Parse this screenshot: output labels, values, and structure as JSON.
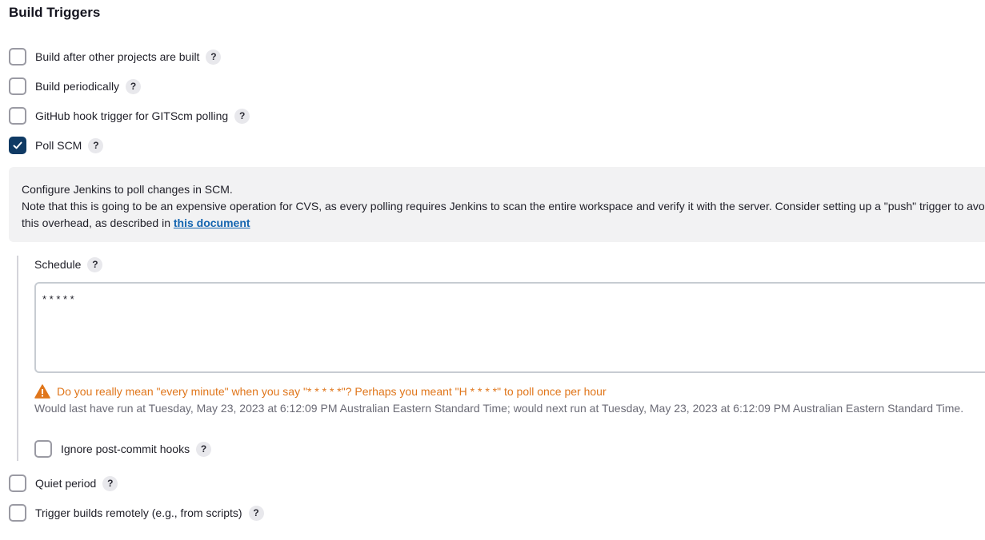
{
  "section": {
    "title": "Build Triggers"
  },
  "triggers": [
    {
      "label": "Build after other projects are built",
      "checked": false
    },
    {
      "label": "Build periodically",
      "checked": false
    },
    {
      "label": "GitHub hook trigger for GITScm polling",
      "checked": false
    },
    {
      "label": "Poll SCM",
      "checked": true
    }
  ],
  "help_symbol": "?",
  "poll_scm": {
    "description_line1": "Configure Jenkins to poll changes in SCM.",
    "description_line2": "Note that this is going to be an expensive operation for CVS, as every polling requires Jenkins to scan the entire workspace and verify it with the server. Consider setting up a \"push\" trigger to avoid",
    "description_line3_prefix": "this overhead, as described in ",
    "description_link": "this document",
    "schedule_label": "Schedule",
    "schedule_value": "* * * * *",
    "warning_text": "Do you really mean \"every minute\" when you say \"* * * * *\"? Perhaps you meant \"H * * * *\" to poll once per hour",
    "run_info": "Would last have run at Tuesday, May 23, 2023 at 6:12:09 PM Australian Eastern Standard Time; would next run at Tuesday, May 23, 2023 at 6:12:09 PM Australian Eastern Standard Time.",
    "ignore_hooks_label": "Ignore post-commit hooks",
    "ignore_hooks_checked": false
  },
  "more_triggers": [
    {
      "label": "Quiet period",
      "checked": false
    },
    {
      "label": "Trigger builds remotely (e.g., from scripts)",
      "checked": false
    }
  ],
  "colors": {
    "checkbox_checked": "#0f3a64",
    "warning": "#e0761b",
    "link": "#1565b0",
    "info_background": "#f2f2f3"
  },
  "icons": {
    "checkmark": "check-icon",
    "warning": "warning-triangle-icon",
    "help": "help-icon"
  }
}
